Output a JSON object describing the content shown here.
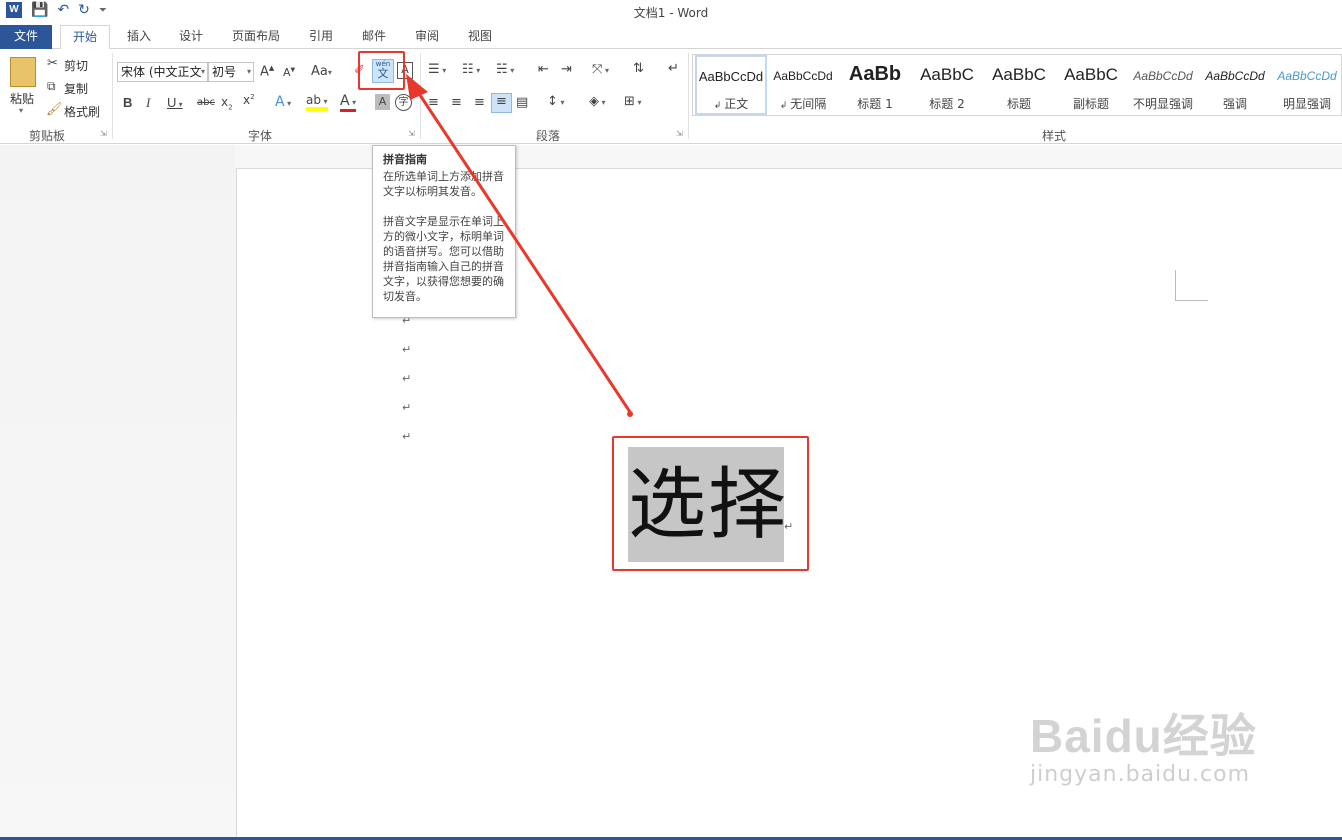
{
  "window": {
    "title": "文档1 - Word"
  },
  "tabs": [
    {
      "label": "文件"
    },
    {
      "label": "开始"
    },
    {
      "label": "插入"
    },
    {
      "label": "设计"
    },
    {
      "label": "页面布局"
    },
    {
      "label": "引用"
    },
    {
      "label": "邮件"
    },
    {
      "label": "审阅"
    },
    {
      "label": "视图"
    }
  ],
  "clipboard": {
    "paste": "粘贴",
    "cut": "剪切",
    "copy": "复制",
    "format_painter": "格式刷",
    "group": "剪贴板"
  },
  "font": {
    "name": "宋体 (中文正文",
    "size": "初号",
    "case_label": "Aa",
    "group": "字体",
    "phonetic_top": "wén",
    "phonetic_bottom": "文"
  },
  "paragraph": {
    "group": "段落"
  },
  "styles": {
    "group": "样式",
    "items": [
      {
        "sample": "AaBbCcDd",
        "name": "正文"
      },
      {
        "sample": "AaBbCcDd",
        "name": "无间隔"
      },
      {
        "sample": "AaBb",
        "name": "标题 1"
      },
      {
        "sample": "AaBbC",
        "name": "标题 2"
      },
      {
        "sample": "AaBbC",
        "name": "标题"
      },
      {
        "sample": "AaBbC",
        "name": "副标题"
      },
      {
        "sample": "AaBbCcDd",
        "name": "不明显强调"
      },
      {
        "sample": "AaBbCcDd",
        "name": "强调"
      },
      {
        "sample": "AaBbCcDd",
        "name": "明显强调"
      }
    ]
  },
  "tooltip": {
    "title": "拼音指南",
    "line1": "在所选单词上方添加拼音文字以标明其发音。",
    "line2": "拼音文字是显示在单词上方的微小文字，标明单词的语音拼写。您可以借助拼音指南输入自己的拼音文字，以获得您想要的确切发音。"
  },
  "document": {
    "selected_text": "选择",
    "para_mark": "↵"
  },
  "watermark": {
    "logo": "Baidu经验",
    "url": "jingyan.baidu.com"
  },
  "colors": {
    "accent": "#2b579a",
    "annotation": "#e8382b"
  }
}
